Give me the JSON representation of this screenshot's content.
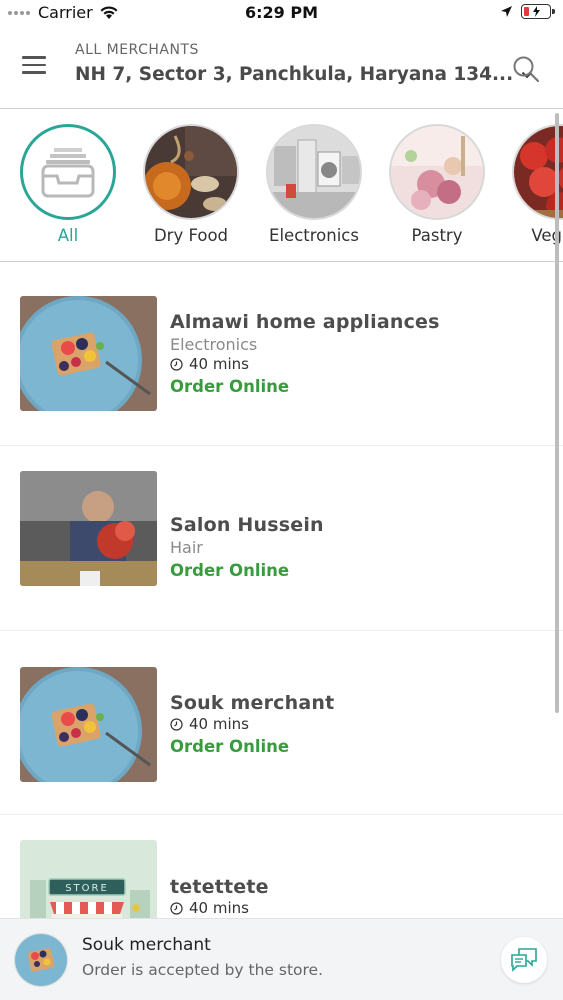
{
  "status_bar": {
    "carrier": "Carrier",
    "time": "6:29 PM",
    "battery_level": 0.2
  },
  "header": {
    "label": "ALL MERCHANTS",
    "address": "NH 7, Sector 3, Panchkula, Haryana 134..."
  },
  "categories": [
    {
      "label": "All",
      "active": true,
      "icon": "inbox-tray-icon"
    },
    {
      "label": "Dry Food",
      "active": false
    },
    {
      "label": "Electronics",
      "active": false
    },
    {
      "label": "Pastry",
      "active": false
    },
    {
      "label": "Vegeta",
      "active": false
    }
  ],
  "merchants": [
    {
      "name": "Almawi home appliances",
      "category": "Electronics",
      "time": "40 mins",
      "order": "Order Online"
    },
    {
      "name": "Salon Hussein",
      "category": "Hair",
      "order": "Order Online"
    },
    {
      "name": "Souk merchant",
      "time": "40 mins",
      "order": "Order Online"
    },
    {
      "name": "tetettete",
      "time": "40 mins",
      "store_sign": "STORE"
    }
  ],
  "notification": {
    "title": "Souk merchant",
    "message": "Order is accepted by the store."
  },
  "colors": {
    "accent": "#2aa596",
    "order_green": "#3a9a3e",
    "battery_low": "#e23b3b"
  }
}
